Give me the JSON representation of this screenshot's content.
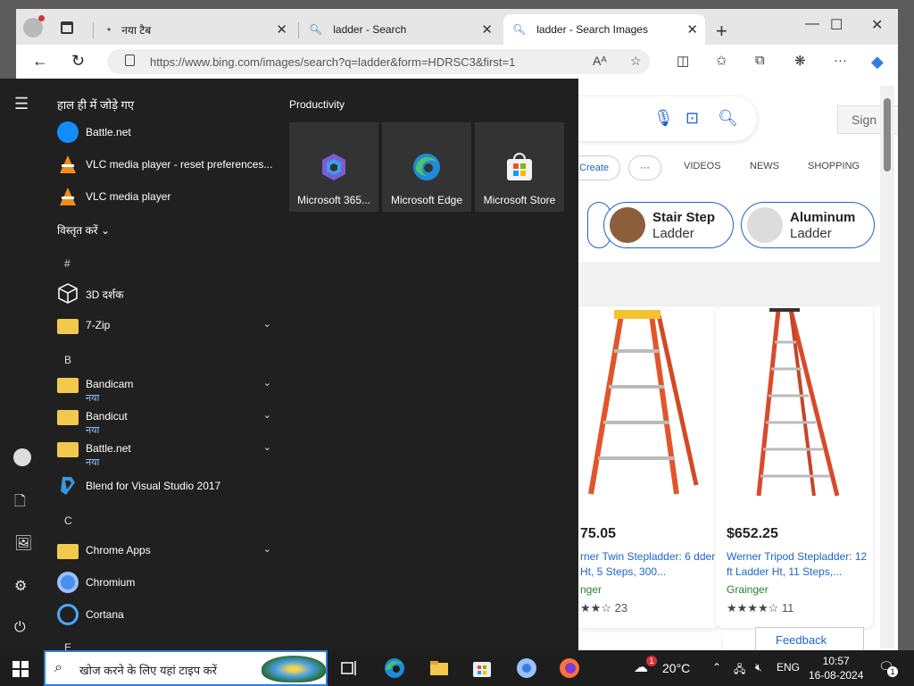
{
  "browser": {
    "tabs": [
      {
        "label": "नया टैब",
        "active": false
      },
      {
        "label": "ladder - Search",
        "active": false
      },
      {
        "label": "ladder - Search Images",
        "active": true
      }
    ],
    "url": "https://www.bing.com/images/search?q=ladder&form=HDRSC3&first=1"
  },
  "bing": {
    "signin": "Sign i",
    "create": "Create",
    "more": "···",
    "nav": [
      "VIDEOS",
      "NEWS",
      "SHOPPING"
    ],
    "chips": [
      {
        "title": "Stair Step",
        "subtitle": "Ladder"
      },
      {
        "title": "Aluminum",
        "subtitle": "Ladder"
      }
    ],
    "results": [
      {
        "price": "75.05",
        "title": "rner Twin Stepladder: 6 dder Ht, 5 Steps, 300...",
        "store": "nger",
        "rating_count": "23",
        "stars": 3.5
      },
      {
        "price": "$652.25",
        "title": "Werner Tripod Stepladder: 12 ft Ladder Ht, 11 Steps,...",
        "store": "Grainger",
        "rating_count": "11",
        "stars": 4.5
      }
    ],
    "feedback": "Feedback"
  },
  "start_menu": {
    "recent_header": "हाल ही में जोड़े गए",
    "recent": [
      {
        "label": "Battle.net",
        "icon": "battlenet-icon"
      },
      {
        "label": "VLC media player - reset preferences...",
        "icon": "vlc-icon"
      },
      {
        "label": "VLC media player",
        "icon": "vlc-icon"
      }
    ],
    "expand": "विस्तृत करें",
    "letters": [
      "#",
      "B",
      "C",
      "E"
    ],
    "apps_hash": [
      {
        "label": "3D दर्शक",
        "icon": "cube-icon"
      },
      {
        "label": "7-Zip",
        "icon": "folder-icon",
        "chevron": true
      }
    ],
    "apps_b": [
      {
        "label": "Bandicam",
        "sub": "नया",
        "icon": "folder-icon",
        "chevron": true
      },
      {
        "label": "Bandicut",
        "sub": "नया",
        "icon": "folder-icon",
        "chevron": true
      },
      {
        "label": "Battle.net",
        "sub": "नया",
        "icon": "folder-icon",
        "chevron": true
      },
      {
        "label": "Blend for Visual Studio 2017",
        "icon": "blend-icon"
      }
    ],
    "apps_c": [
      {
        "label": "Chrome Apps",
        "icon": "folder-icon",
        "chevron": true
      },
      {
        "label": "Chromium",
        "icon": "chromium-icon"
      },
      {
        "label": "Cortana",
        "icon": "cortana-icon"
      }
    ],
    "pinned_header": "Productivity",
    "pinned": [
      {
        "label": "Microsoft 365...",
        "icon": "m365-icon"
      },
      {
        "label": "Microsoft Edge",
        "icon": "edge-icon"
      },
      {
        "label": "Microsoft Store",
        "icon": "store-icon"
      }
    ]
  },
  "taskbar": {
    "search_placeholder": "खोज करने के लिए यहां टाइप करें",
    "weather": "20°C",
    "weather_badge": "1",
    "lang": "ENG",
    "time": "10:57",
    "date": "16-08-2024",
    "notif_count": "1"
  },
  "colors": {
    "accent": "#1c64c8",
    "start_bg": "#202020",
    "taskbar_bg": "#1d1d1d"
  }
}
